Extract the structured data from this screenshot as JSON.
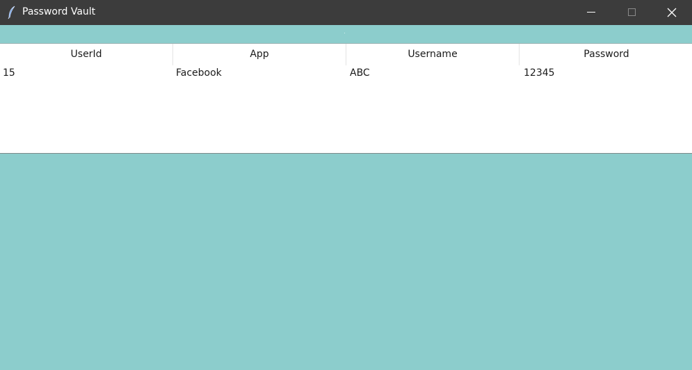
{
  "window": {
    "title": "Password Vault",
    "icon": "feather-icon",
    "background_color": "#8ccdcc",
    "titlebar_color": "#3c3c3c"
  },
  "table": {
    "columns": [
      "UserId",
      "App",
      "Username",
      "Password"
    ],
    "rows": [
      [
        "15",
        "Facebook",
        "ABC",
        "12345"
      ]
    ]
  }
}
